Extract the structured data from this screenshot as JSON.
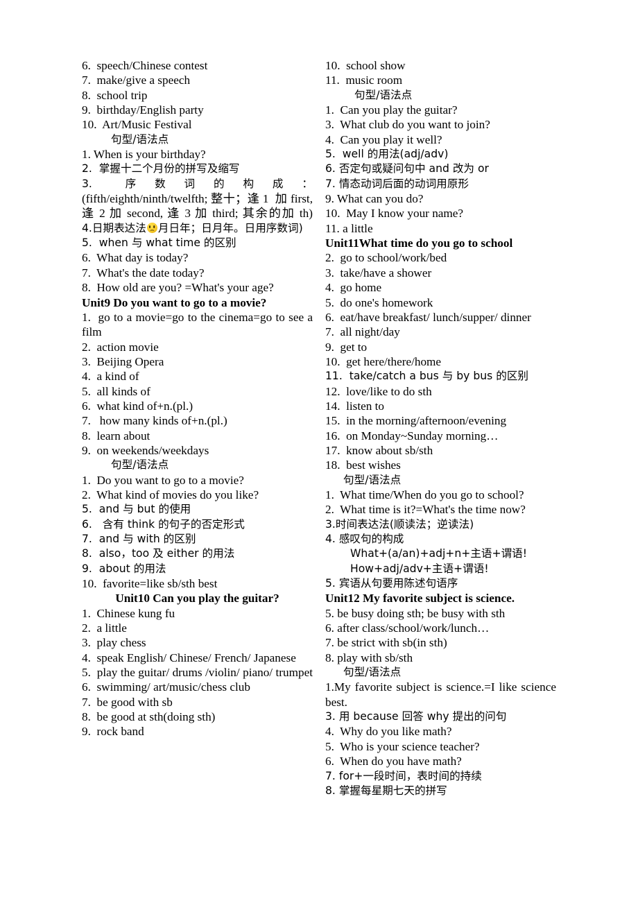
{
  "document": {
    "type": "study-notes",
    "language": "zh-CN/en",
    "grammar_heading": "句型/语法点"
  },
  "left_column": {
    "vocab_unit8_continued": [
      "6.  speech/Chinese contest",
      "7.  make/give a speech",
      "8.  school trip",
      "9.  birthday/English party",
      "10.  Art/Music Festival"
    ],
    "grammar_label_1": "句型/语法点",
    "grammar_unit8": [
      "1. When is your birthday?",
      "2.  掌握十二个月份的拼写及缩写"
    ],
    "ordinal_rule_header": "3.   序 数 词 的 构 成 ：",
    "ordinal_rule_body": "(fifth/eighth/ninth/twelfth; 整十；逢 1  加 first, 逢 2 加 second, 逢 3 加 third; 其余的加 th)",
    "date_rule_pre": "4.日期表达法",
    "date_rule_emoji": "worried-face-emoji",
    "date_rule_post": "月日年；日月年。日用序数词)",
    "grammar_unit8_rest": [
      "5.  when 与 what time 的区别",
      "6.  What day is today?",
      "7.  What's the date today?",
      "8.  How old are you? =What's your age?"
    ],
    "unit9_title": "Unit9 Do you want to go to a movie?",
    "unit9_vocab_1": "1.  go to a movie=go to the cinema=go to see a film",
    "unit9_vocab": [
      "2.  action movie",
      "3.  Beijing Opera",
      "4.  a kind of",
      "5.  all kinds of",
      "6.  what kind of+n.(pl.)",
      "7.   how many kinds of+n.(pl.)",
      "8.  learn about",
      "9.  on weekends/weekdays"
    ],
    "grammar_label_2": "句型/语法点",
    "grammar_unit9": [
      "1.  Do you want to go to a movie?",
      "2.  What kind of movies do you like?",
      "5.  and 与 but 的使用",
      "6.   含有 think 的句子的否定形式",
      "7.  and 与 with 的区别",
      "8.  also，too 及 either 的用法",
      "9.  about 的用法",
      "10.  favorite=like sb/sth best"
    ],
    "unit10_title": "Unit10 Can you play the guitar?",
    "unit10_vocab": [
      "1.  Chinese kung fu",
      "2.  a little",
      "3.  play chess",
      "4.  speak English/ Chinese/ French/ Japanese"
    ],
    "unit10_vocab_5": "5.  play the guitar/ drums /violin/ piano/ trumpet",
    "unit10_vocab_rest": [
      "6.  swimming/ art/music/chess club",
      "7.  be good with sb",
      "8.  be good at sth(doing sth)",
      "9.  rock band"
    ]
  },
  "right_column": {
    "unit10_vocab_cont": [
      "10.  school show",
      "11.  music room"
    ],
    "grammar_label_1": "句型/语法点",
    "grammar_unit10": [
      "1.  Can you play the guitar?",
      "3.  What club do you want to join?",
      "4.  Can you play it well?",
      "5.  well 的用法(adj/adv)",
      "6. 否定句或疑问句中 and 改为 or",
      "7. 情态动词后面的动词用原形",
      "9. What can you do?",
      "10.  May I know your name?",
      "11. a little"
    ],
    "unit11_title": "Unit11What time do you go to school",
    "unit11_vocab": [
      "2.  go to school/work/bed",
      "3.  take/have a shower",
      "4.  go home",
      "5.  do one's homework",
      "6.  eat/have breakfast/ lunch/supper/ dinner",
      "7.  all night/day",
      "9.  get to",
      "10.  get here/there/home",
      "11.  take/catch a bus 与 by bus 的区别",
      "12.  love/like to do sth",
      "14.  listen to",
      "15.  in the morning/afternoon/evening",
      "16.  on Monday~Sunday morning…",
      "17.  know about sb/sth",
      "18.  best wishes"
    ],
    "grammar_label_2": "句型/语法点",
    "grammar_unit11": [
      "1.  What time/When do you go to school?",
      "2.  What time is it?=What's the time now?",
      "3.时间表达法(顺读法；逆读法)",
      "4. 感叹句的构成"
    ],
    "exclamation_patterns": [
      "What+(a/an)+adj+n+主语+谓语!",
      "How+adj/adv+主语+谓语!"
    ],
    "grammar_unit11_last": "5. 宾语从句要用陈述句语序",
    "unit12_title": "Unit12 My favorite subject is science.",
    "unit12_vocab": [
      "5. be busy doing sth; be busy with sth",
      "6. after class/school/work/lunch…",
      "7. be strict with sb(in sth)",
      "8. play with sb/sth"
    ],
    "grammar_label_3": "句型/语法点",
    "grammar_unit12_1": "1.My favorite subject is science.=I like science best.",
    "grammar_unit12": [
      "3. 用 because 回答 why 提出的问句",
      "4.  Why do you like math?",
      "5.  Who is your science teacher?",
      "6.  When do you have math?",
      "7. for+一段时间，表时间的持续",
      "8. 掌握每星期七天的拼写"
    ]
  }
}
